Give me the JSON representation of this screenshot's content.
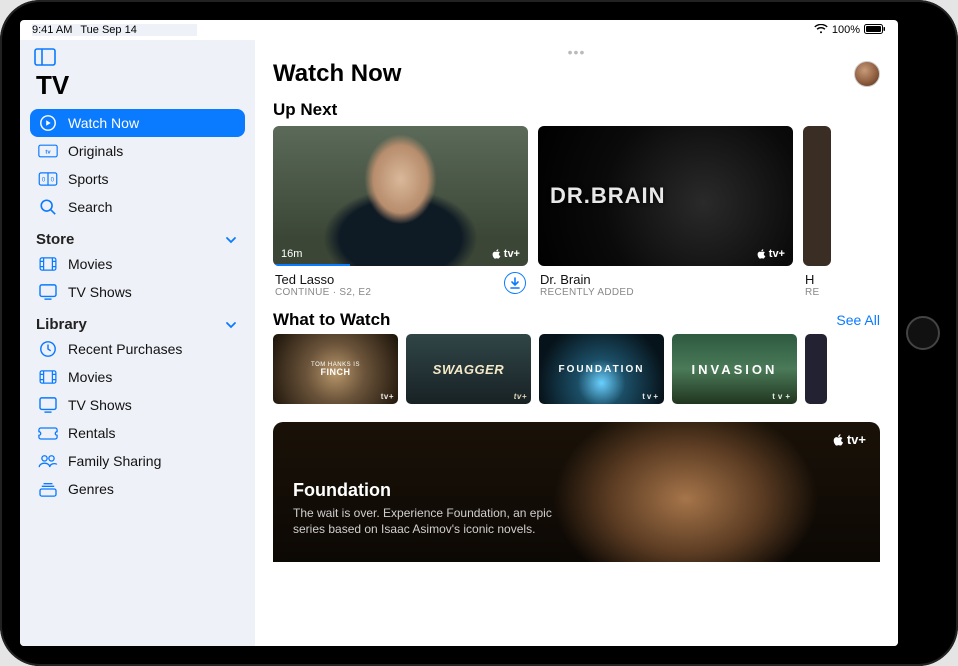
{
  "status": {
    "time": "9:41 AM",
    "date": "Tue Sep 14",
    "battery_pct": "100%"
  },
  "sidebar": {
    "title": "TV",
    "items": [
      {
        "label": "Watch Now",
        "icon": "play-circle",
        "selected": true
      },
      {
        "label": "Originals",
        "icon": "atv-badge"
      },
      {
        "label": "Sports",
        "icon": "scoreboard"
      },
      {
        "label": "Search",
        "icon": "magnifier"
      }
    ],
    "sections": [
      {
        "title": "Store",
        "items": [
          {
            "label": "Movies",
            "icon": "film"
          },
          {
            "label": "TV Shows",
            "icon": "tv"
          }
        ]
      },
      {
        "title": "Library",
        "items": [
          {
            "label": "Recent Purchases",
            "icon": "clock"
          },
          {
            "label": "Movies",
            "icon": "film"
          },
          {
            "label": "TV Shows",
            "icon": "tv"
          },
          {
            "label": "Rentals",
            "icon": "ticket"
          },
          {
            "label": "Family Sharing",
            "icon": "people"
          },
          {
            "label": "Genres",
            "icon": "stack"
          }
        ]
      }
    ]
  },
  "main": {
    "title": "Watch Now",
    "up_next": {
      "title": "Up Next",
      "cards": [
        {
          "title": "Ted Lasso",
          "subtitle": "CONTINUE · S2, E2",
          "badge_time": "16m",
          "provider": "tv+",
          "logo_text": "",
          "img": "ted",
          "downloadable": true
        },
        {
          "title": "Dr. Brain",
          "subtitle": "RECENTLY ADDED",
          "badge_time": "",
          "provider": "tv+",
          "logo_text": "DR.BRAIN",
          "img": "brain",
          "downloadable": false
        },
        {
          "title": "H",
          "subtitle": "RE",
          "badge_time": "",
          "provider": "",
          "logo_text": "",
          "img": "peek",
          "downloadable": false
        }
      ]
    },
    "what_to_watch": {
      "title": "What to Watch",
      "see_all": "See All",
      "thumbs": [
        {
          "label": "FINCH",
          "sub": "TOM HANKS IS",
          "cls": "t-finch"
        },
        {
          "label": "SWAGGER",
          "sub": "",
          "cls": "t-swagger"
        },
        {
          "label": "FOUNDATION",
          "sub": "",
          "cls": "t-foundation"
        },
        {
          "label": "INVASION",
          "sub": "",
          "cls": "t-invasion"
        }
      ]
    },
    "hero": {
      "title": "Foundation",
      "desc": "The wait is over. Experience Foundation, an epic series based on Isaac Asimov's iconic novels.",
      "provider": "tv+"
    }
  }
}
